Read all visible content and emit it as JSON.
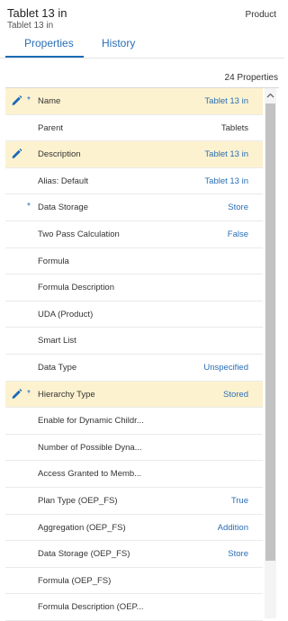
{
  "header": {
    "title": "Tablet 13 in",
    "subtitle": "Tablet 13 in",
    "dimension": "Product"
  },
  "tabs": [
    {
      "label": "Properties",
      "active": true
    },
    {
      "label": "History",
      "active": false
    }
  ],
  "properties_count": "24 Properties",
  "colors": {
    "accent": "#1b6bb7",
    "highlight_row": "#fdf2d0",
    "value_text": "#2a6fb5"
  },
  "rows": [
    {
      "label": "Name",
      "value": "Tablet 13 in",
      "edit": true,
      "required": true,
      "highlight": true
    },
    {
      "label": "Parent",
      "value": "Tablets",
      "edit": false,
      "required": false,
      "highlight": false,
      "value_dark": true
    },
    {
      "label": "Description",
      "value": "Tablet 13 in",
      "edit": true,
      "required": false,
      "highlight": true
    },
    {
      "label": "Alias: Default",
      "value": "Tablet 13 in",
      "edit": false,
      "required": false,
      "highlight": false
    },
    {
      "label": "Data Storage",
      "value": "Store",
      "edit": false,
      "required": true,
      "highlight": false
    },
    {
      "label": "Two Pass Calculation",
      "value": "False",
      "edit": false,
      "required": false,
      "highlight": false
    },
    {
      "label": "Formula",
      "value": "",
      "edit": false,
      "required": false,
      "highlight": false
    },
    {
      "label": "Formula Description",
      "value": "",
      "edit": false,
      "required": false,
      "highlight": false
    },
    {
      "label": "UDA (Product)",
      "value": "",
      "edit": false,
      "required": false,
      "highlight": false
    },
    {
      "label": "Smart List",
      "value": "",
      "edit": false,
      "required": false,
      "highlight": false
    },
    {
      "label": "Data Type",
      "value": "Unspecified",
      "edit": false,
      "required": false,
      "highlight": false
    },
    {
      "label": "Hierarchy Type",
      "value": "Stored",
      "edit": true,
      "required": true,
      "highlight": true
    },
    {
      "label": "Enable for Dynamic Childr...",
      "value": "",
      "edit": false,
      "required": false,
      "highlight": false
    },
    {
      "label": "Number of Possible Dyna...",
      "value": "",
      "edit": false,
      "required": false,
      "highlight": false
    },
    {
      "label": "Access Granted to Memb...",
      "value": "",
      "edit": false,
      "required": false,
      "highlight": false
    },
    {
      "label": "Plan Type (OEP_FS)",
      "value": "True",
      "edit": false,
      "required": false,
      "highlight": false
    },
    {
      "label": "Aggregation (OEP_FS)",
      "value": "Addition",
      "edit": false,
      "required": false,
      "highlight": false
    },
    {
      "label": "Data Storage (OEP_FS)",
      "value": "Store",
      "edit": false,
      "required": false,
      "highlight": false
    },
    {
      "label": "Formula (OEP_FS)",
      "value": "",
      "edit": false,
      "required": false,
      "highlight": false
    },
    {
      "label": "Formula Description (OEP...",
      "value": "",
      "edit": false,
      "required": false,
      "highlight": false
    }
  ],
  "icons": {
    "edit": "pencil-icon",
    "required": "asterisk-icon",
    "scroll_up": "chevron-up-icon"
  }
}
